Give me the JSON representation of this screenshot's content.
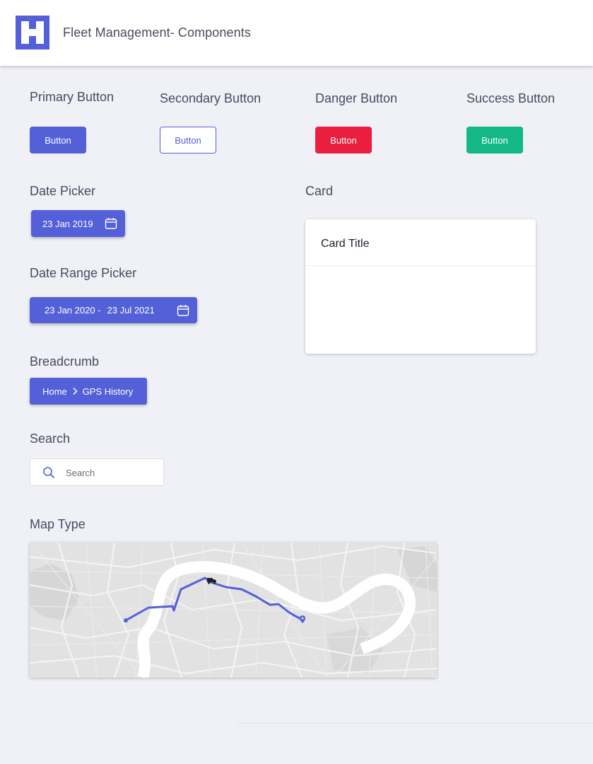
{
  "header": {
    "title": "Fleet Management- Components",
    "logo_color": "#5360d8"
  },
  "buttons": {
    "primary": {
      "heading": "Primary Button",
      "label": "Button",
      "color": "#5360d8"
    },
    "secondary": {
      "heading": "Secondary Button",
      "label": "Button",
      "color": "#5360d8"
    },
    "danger": {
      "heading": "Danger Button",
      "label": "Button",
      "color": "#ea1f3d"
    },
    "success": {
      "heading": "Success Button",
      "label": "Button",
      "color": "#12b886"
    }
  },
  "date_picker": {
    "heading": "Date Picker",
    "value": "23 Jan 2019",
    "icon": "calendar-icon"
  },
  "date_range_picker": {
    "heading": "Date Range Picker",
    "start": "23 Jan 2020 -",
    "end": "23 Jul 2021",
    "icon": "calendar-icon"
  },
  "breadcrumb": {
    "heading": "Breadcrumb",
    "items": [
      "Home",
      "GPS History"
    ],
    "separator_icon": "chevron-right-icon"
  },
  "search": {
    "heading": "Search",
    "placeholder": "Search",
    "icon": "search-icon"
  },
  "card": {
    "heading": "Card",
    "title": "Card Title"
  },
  "map": {
    "heading": "Map Type",
    "route_color": "#5360d8",
    "vehicle_icon": "truck-icon",
    "pin_icon": "location-pin-icon"
  }
}
